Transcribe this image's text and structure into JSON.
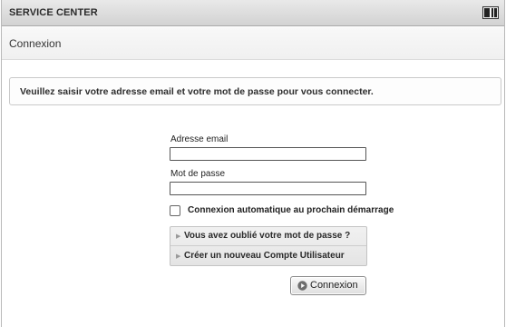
{
  "titlebar": {
    "title": "SERVICE CENTER",
    "icon": "window-icon"
  },
  "section": {
    "title": "Connexion"
  },
  "info": {
    "text": "Veuillez saisir votre adresse email et votre mot de passe pour vous connecter."
  },
  "form": {
    "email_label": "Adresse email",
    "email_value": "",
    "password_label": "Mot de passe",
    "password_value": "",
    "auto_login_label": "Connexion automatique au prochain démarrage",
    "auto_login_checked": false
  },
  "links": {
    "forgot_password": "Vous avez oublié votre mot de passe ?",
    "create_account": "Créer un nouveau Compte Utilisateur",
    "arrow_icon": "triangle-right-icon"
  },
  "login_button": {
    "label": "Connexion",
    "icon": "play-circle-icon"
  },
  "colors": {
    "titlebar": "#d8d8d8",
    "border": "#c9c9c9",
    "text": "#222222"
  }
}
